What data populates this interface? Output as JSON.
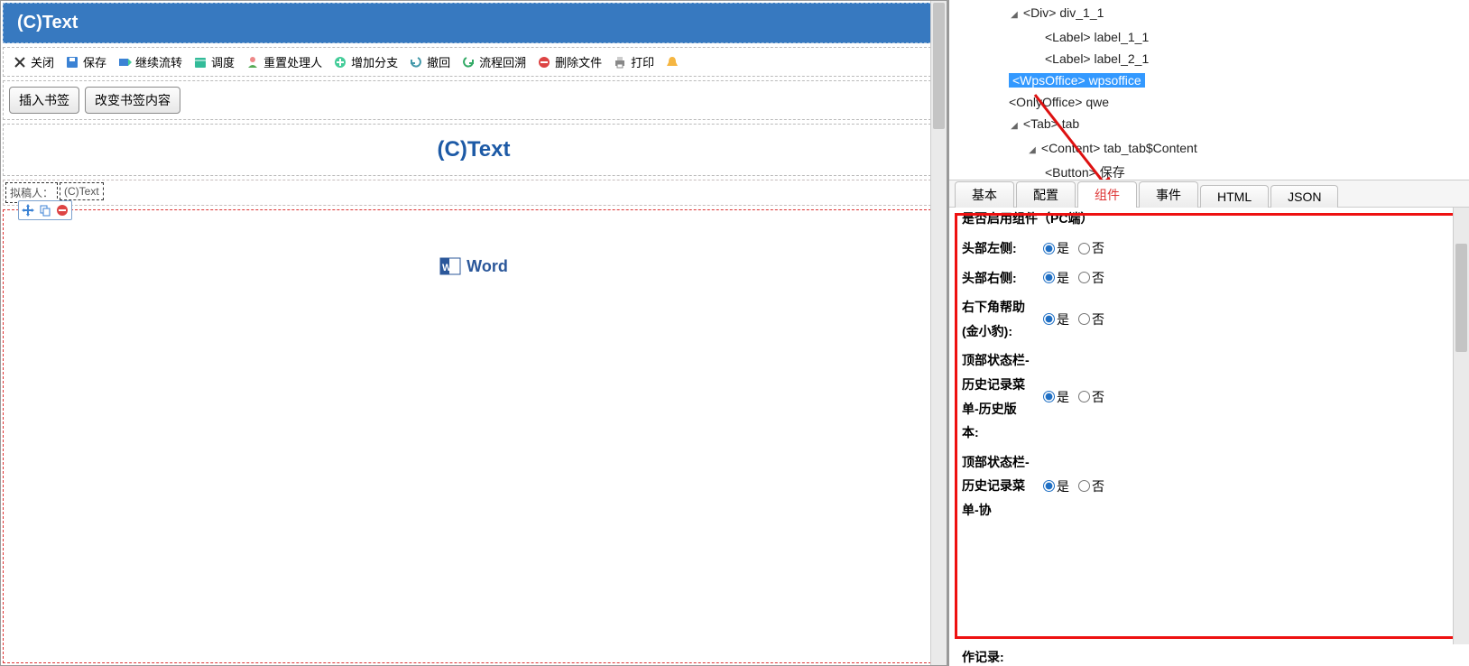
{
  "title_bar": "(C)Text",
  "toolbar": {
    "close": "关闭",
    "save": "保存",
    "continue_flow": "继续流转",
    "schedule": "调度",
    "reset_handler": "重置处理人",
    "add_branch": "增加分支",
    "undo": "撤回",
    "flow_back": "流程回溯",
    "delete_file": "删除文件",
    "print": "打印"
  },
  "sub_toolbar": {
    "insert_bookmark": "插入书签",
    "change_bookmark": "改变书签内容"
  },
  "content_title": "(C)Text",
  "small_boxes": {
    "box1": "拟稿人：",
    "box2": "(C)Text"
  },
  "word_label": "Word",
  "tree": {
    "n0": {
      "exp": "◢",
      "tag": "<Div>",
      "name": "div_1_1",
      "indent": 60
    },
    "n1": {
      "exp": "",
      "tag": "<Label>",
      "name": "label_1_1",
      "indent": 100
    },
    "n2": {
      "exp": "",
      "tag": "<Label>",
      "name": "label_2_1",
      "indent": 100
    },
    "n3": {
      "exp": "",
      "tag": "<WpsOffice>",
      "name": "wpsoffice",
      "indent": 60,
      "selected": true
    },
    "n4": {
      "exp": "",
      "tag": "<OnlyOffice>",
      "name": "qwe",
      "indent": 60
    },
    "n5": {
      "exp": "◢",
      "tag": "<Tab>",
      "name": "tab",
      "indent": 60
    },
    "n6": {
      "exp": "◢",
      "tag": "<Content>",
      "name": "tab_tab$Content",
      "indent": 80
    },
    "n7": {
      "exp": "",
      "tag": "<Button>",
      "name": "保存",
      "indent": 100
    }
  },
  "tabs": {
    "basic": "基本",
    "config": "配置",
    "component": "组件",
    "event": "事件",
    "html": "HTML",
    "json": "JSON"
  },
  "props": {
    "heading": "是否启用组件（PC端）",
    "yes": "是",
    "no": "否",
    "rows": {
      "r1": "头部左侧:",
      "r2": "头部右侧:",
      "r3": "右下角帮助(金小豹):",
      "r4": "顶部状态栏-历史记录菜单-历史版本:",
      "r5": "顶部状态栏-历史记录菜单-协",
      "footer": "作记录:"
    }
  }
}
